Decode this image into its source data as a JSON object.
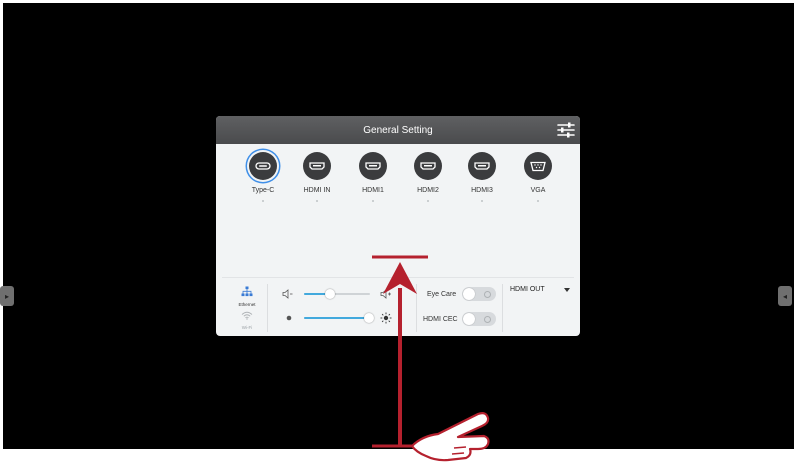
{
  "panel": {
    "title": "General Setting",
    "settings_icon": "sliders-icon"
  },
  "sources": [
    {
      "label": "Type-C",
      "icon": "usb-c-port-icon",
      "active": true
    },
    {
      "label": "HDMI IN",
      "icon": "hdmi-port-icon",
      "active": false
    },
    {
      "label": "HDMI1",
      "icon": "hdmi-port-icon",
      "active": false
    },
    {
      "label": "HDMI2",
      "icon": "hdmi-port-icon",
      "active": false
    },
    {
      "label": "HDMI3",
      "icon": "hdmi-port-icon",
      "active": false
    },
    {
      "label": "VGA",
      "icon": "vga-port-icon",
      "active": false
    }
  ],
  "network": {
    "ethernet_label": "Ethernet",
    "wifi_label": "Wi-Fi"
  },
  "controls": {
    "volume_level": 0.4,
    "brightness_level": 0.98,
    "eye_care_label": "Eye Care",
    "eye_care_on": false,
    "hdmi_cec_label": "HDMI CEC",
    "hdmi_cec_on": false,
    "hdmi_out_label": "HDMI OUT"
  },
  "colors": {
    "accent": "#42a9dd",
    "active_ring": "#3f8fe8",
    "gesture": "#b5212e"
  }
}
